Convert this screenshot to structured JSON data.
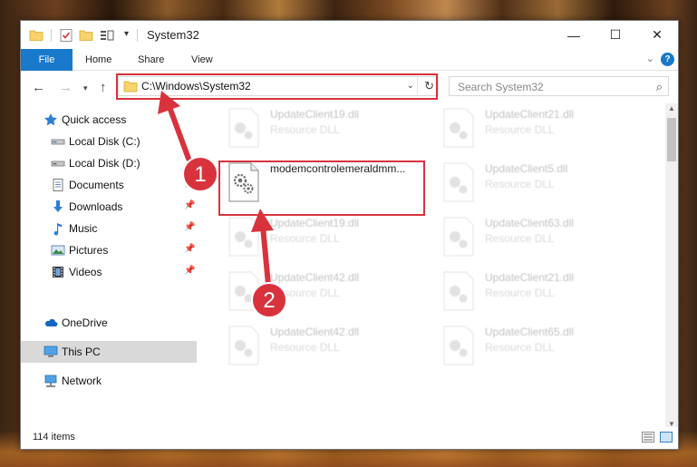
{
  "window": {
    "title": "System32",
    "controls": {
      "minimize": "—",
      "maximize": "☐",
      "close": "✕"
    }
  },
  "ribbon": {
    "tabs": [
      "File",
      "Home",
      "Share",
      "View"
    ],
    "help": "?"
  },
  "address": {
    "path": "C:\\Windows\\System32",
    "search_placeholder": "Search System32"
  },
  "sidebar": {
    "items": [
      {
        "label": "Quick access",
        "icon": "star-icon",
        "pinned": false
      },
      {
        "label": "Local Disk (C:)",
        "icon": "drive-icon",
        "pinned": false
      },
      {
        "label": "Local Disk (D:)",
        "icon": "drive-icon",
        "pinned": false
      },
      {
        "label": "Documents",
        "icon": "documents-icon",
        "pinned": true
      },
      {
        "label": "Downloads",
        "icon": "download-icon",
        "pinned": true
      },
      {
        "label": "Music",
        "icon": "music-icon",
        "pinned": true
      },
      {
        "label": "Pictures",
        "icon": "pictures-icon",
        "pinned": true
      },
      {
        "label": "Videos",
        "icon": "videos-icon",
        "pinned": true
      },
      {
        "label": "OneDrive",
        "icon": "cloud-icon",
        "pinned": false
      },
      {
        "label": "This PC",
        "icon": "computer-icon",
        "pinned": false,
        "selected": true
      },
      {
        "label": "Network",
        "icon": "network-icon",
        "pinned": false
      }
    ]
  },
  "files": {
    "left": [
      {
        "name": "UpdateClient19.dll",
        "type": "Resource DLL"
      },
      {
        "name": "modemcontrolemeraldmm...",
        "type": "",
        "highlighted": true
      },
      {
        "name": "UpdateClient19.dll",
        "type": "Resource DLL"
      },
      {
        "name": "UpdateClient42.dll",
        "type": "Resource DLL"
      },
      {
        "name": "UpdateClient42.dll",
        "type": "Resource DLL"
      }
    ],
    "right": [
      {
        "name": "UpdateClient21.dll",
        "type": "Resource DLL"
      },
      {
        "name": "UpdateClient5.dll",
        "type": "Resource DLL"
      },
      {
        "name": "UpdateClient63.dll",
        "type": "Resource DLL"
      },
      {
        "name": "UpdateClient21.dll",
        "type": "Resource DLL"
      },
      {
        "name": "UpdateClient65.dll",
        "type": "Resource DLL"
      }
    ]
  },
  "status": {
    "item_count": "114 items"
  },
  "annotations": {
    "step1": "1",
    "step2": "2",
    "color": "#d8333d"
  }
}
